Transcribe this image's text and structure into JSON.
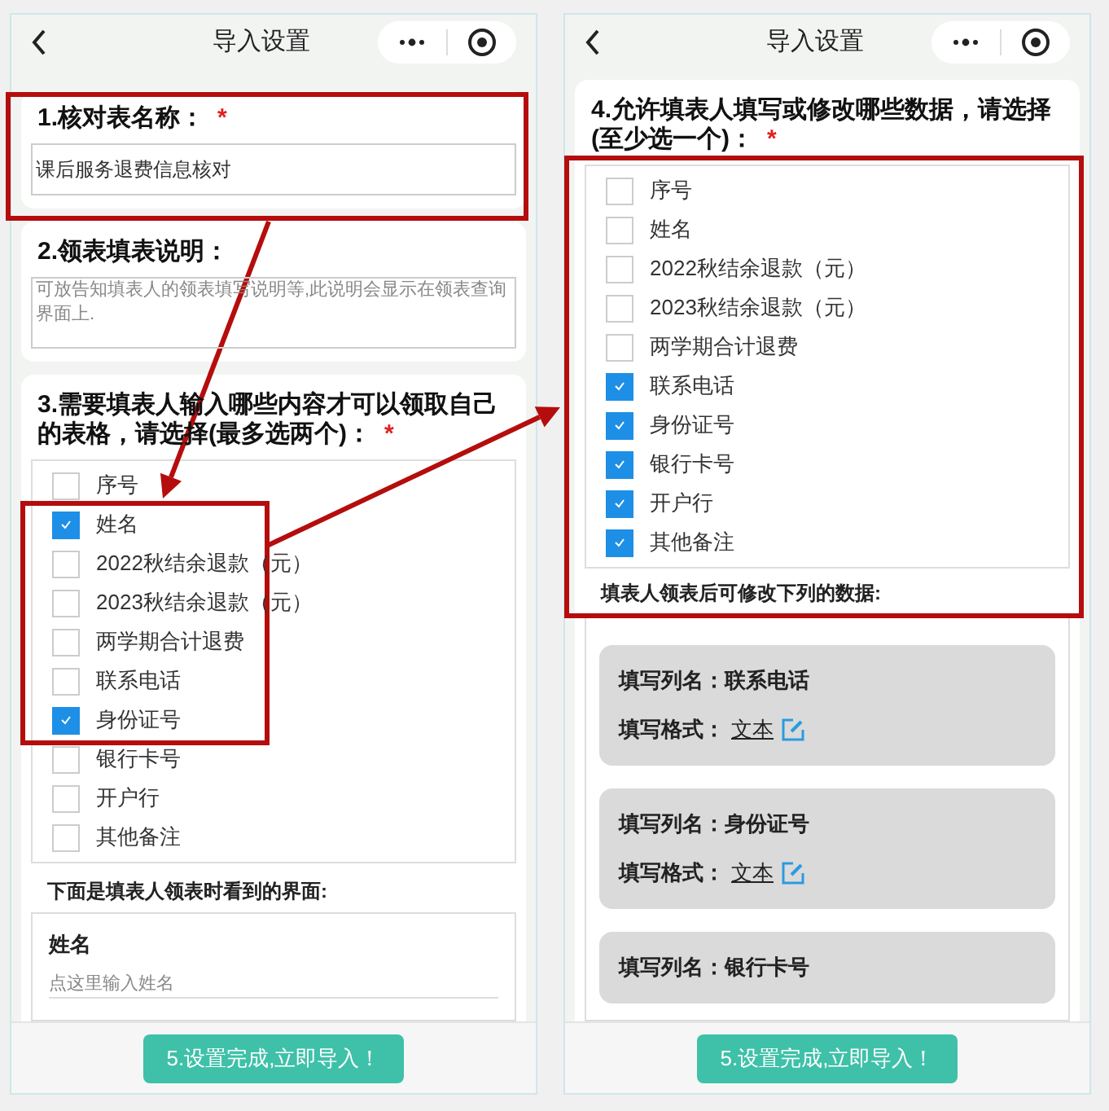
{
  "screens": [
    {
      "title": "导入设置",
      "name_section": {
        "title": "1.核对表名称：",
        "required_mark": "*",
        "value": "课后服务退费信息核对"
      },
      "note_section": {
        "title": "2.领表填表说明：",
        "placeholder": "可放告知填表人的领表填写说明等,此说明会显示在领表查询界面上."
      },
      "lookup_section": {
        "title": "3.需要填表人输入哪些内容才可以领取自己的表格，请选择(最多选两个)：",
        "required_mark": "*",
        "options": [
          {
            "label": "序号",
            "checked": false
          },
          {
            "label": "姓名",
            "checked": true
          },
          {
            "label": "2022秋结余退款（元）",
            "checked": false
          },
          {
            "label": "2023秋结余退款（元）",
            "checked": false
          },
          {
            "label": "两学期合计退费",
            "checked": false
          },
          {
            "label": "联系电话",
            "checked": false
          },
          {
            "label": "身份证号",
            "checked": true
          },
          {
            "label": "银行卡号",
            "checked": false
          },
          {
            "label": "开户行",
            "checked": false
          },
          {
            "label": "其他备注",
            "checked": false
          }
        ],
        "caption": "下面是填表人领表时看到的界面:",
        "preview": {
          "label": "姓名",
          "placeholder": "点这里输入姓名"
        }
      },
      "button": "5.设置完成,立即导入！"
    },
    {
      "title": "导入设置",
      "edit_section": {
        "title": "4.允许填表人填写或修改哪些数据，请选择(至少选一个)：",
        "required_mark": "*",
        "options": [
          {
            "label": "序号",
            "checked": false
          },
          {
            "label": "姓名",
            "checked": false
          },
          {
            "label": "2022秋结余退款（元）",
            "checked": false
          },
          {
            "label": "2023秋结余退款（元）",
            "checked": false
          },
          {
            "label": "两学期合计退费",
            "checked": false
          },
          {
            "label": "联系电话",
            "checked": true
          },
          {
            "label": "身份证号",
            "checked": true
          },
          {
            "label": "银行卡号",
            "checked": true
          },
          {
            "label": "开户行",
            "checked": true
          },
          {
            "label": "其他备注",
            "checked": true
          }
        ],
        "caption": "填表人领表后可修改下列的数据:",
        "cards": [
          {
            "column": "填写列名：联系电话",
            "format_label": "填写格式：",
            "format": "文本"
          },
          {
            "column": "填写列名：身份证号",
            "format_label": "填写格式：",
            "format": "文本"
          },
          {
            "column": "填写列名：银行卡号"
          }
        ]
      },
      "button": "5.设置完成,立即导入！"
    }
  ]
}
